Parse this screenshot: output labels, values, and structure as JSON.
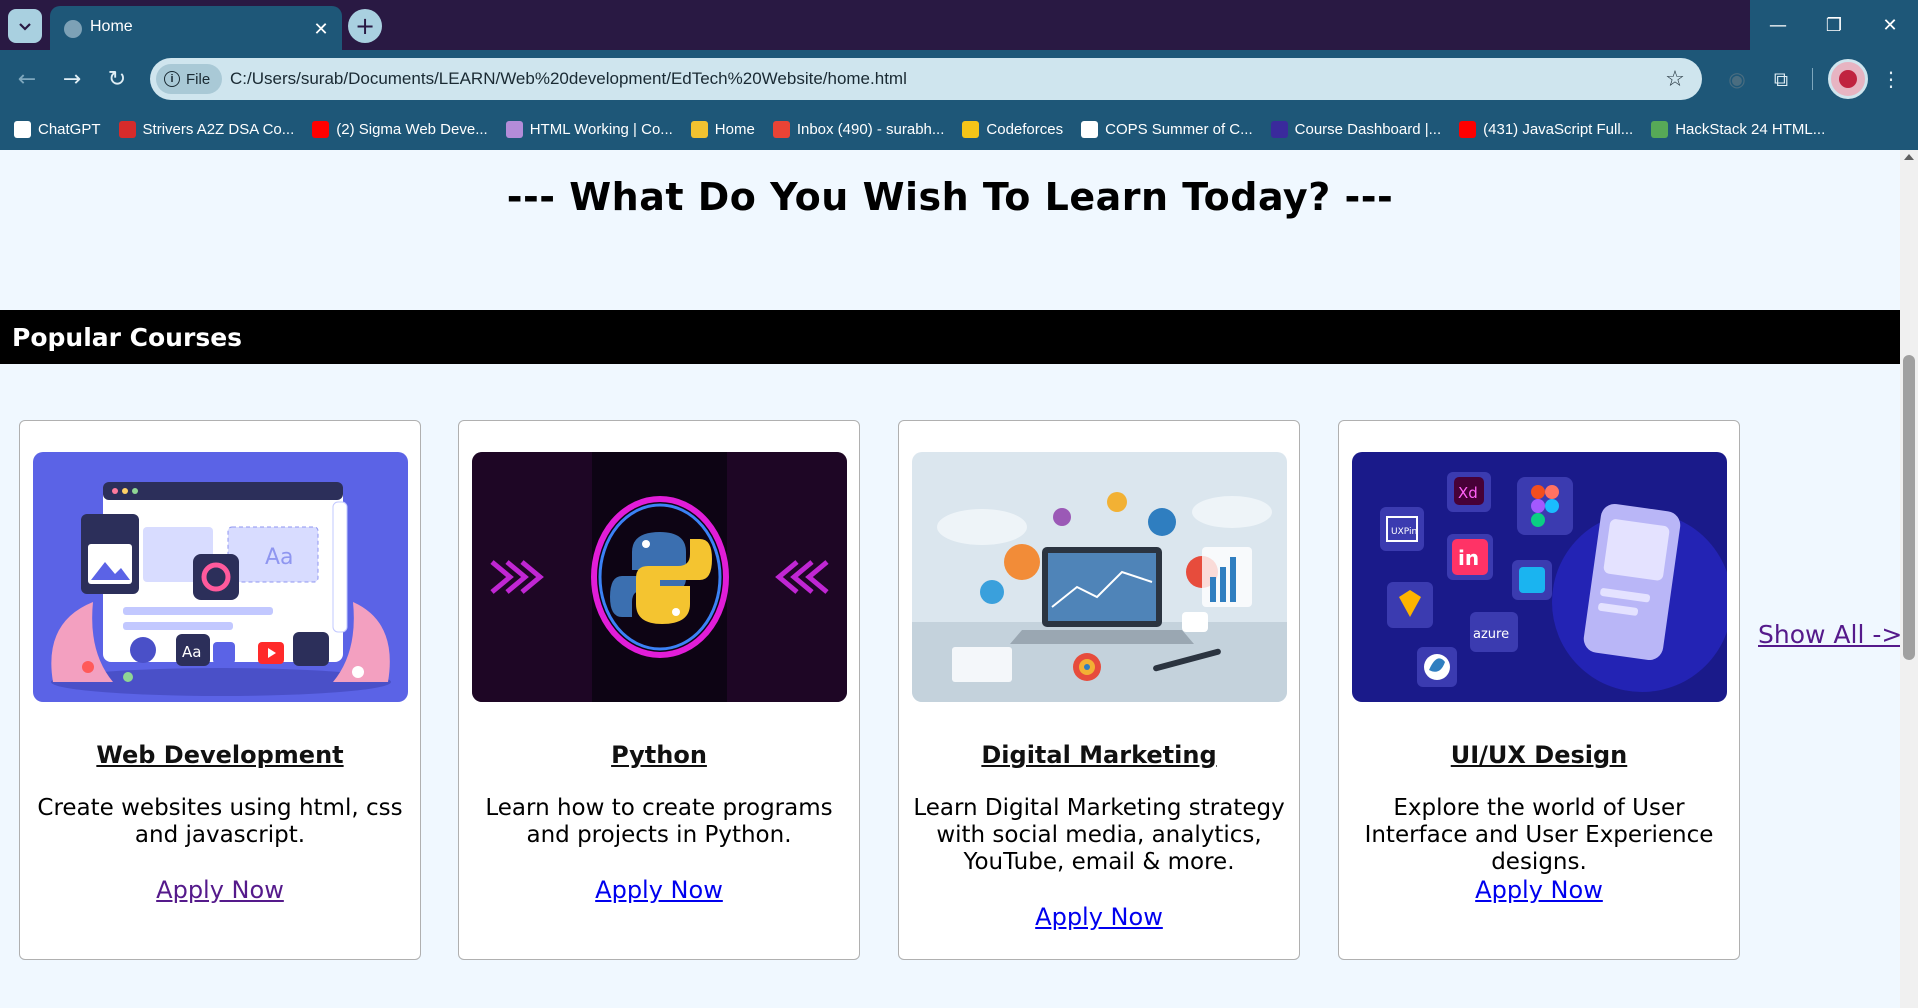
{
  "browser": {
    "tab_title": "Home",
    "tab_close_glyph": "✕",
    "new_tab_glyph": "+",
    "site_chip_label": "File",
    "url": "C:/Users/surab/Documents/LEARN/Web%20development/EdTech%20Website/home.html",
    "window_controls": {
      "minimize": "—",
      "restore": "❐",
      "close": "✕"
    },
    "nav": {
      "back": "←",
      "forward": "→",
      "reload": "↻",
      "star": "☆",
      "menu": "⋮",
      "extension": "⧉",
      "lens": "◉"
    }
  },
  "bookmarks": [
    {
      "label": "ChatGPT",
      "icon_color": "#ffffff"
    },
    {
      "label": "Strivers A2Z DSA Co...",
      "icon_color": "#d62b2b"
    },
    {
      "label": "(2) Sigma Web Deve...",
      "icon_color": "#ff0000"
    },
    {
      "label": "HTML Working | Co...",
      "icon_color": "#b38cd9"
    },
    {
      "label": "Home",
      "icon_color": "#f2c230"
    },
    {
      "label": "Inbox (490) - surabh...",
      "icon_color": "#ea4335"
    },
    {
      "label": "Codeforces",
      "icon_color": "#f5c518"
    },
    {
      "label": "COPS Summer of C...",
      "icon_color": "#ffffff"
    },
    {
      "label": "Course Dashboard |...",
      "icon_color": "#3a2a9c"
    },
    {
      "label": "(431) JavaScript Full...",
      "icon_color": "#ff0000"
    },
    {
      "label": "HackStack 24 HTML...",
      "icon_color": "#57a957"
    }
  ],
  "page": {
    "heading": "--- What Do You Wish To Learn Today? ---",
    "section_title": "Popular Courses",
    "show_all": "Show All ->",
    "courses": [
      {
        "title": "Web Development",
        "description": "Create websites using html, css and javascript.",
        "link": "Apply Now",
        "image": "web-development-illustration"
      },
      {
        "title": "Python",
        "description": "Learn how to create programs and projects in Python.",
        "link": "Apply Now",
        "image": "python-neon-logo"
      },
      {
        "title": "Digital Marketing",
        "description": "Learn Digital Marketing strategy with social media, analytics, YouTube, email & more.",
        "link": "Apply Now",
        "image": "digital-marketing-laptop"
      },
      {
        "title": "UI/UX Design",
        "description": "Explore the world of User Interface and User Experience designs.",
        "link": "Apply Now",
        "image": "uiux-tools-icons"
      }
    ]
  },
  "thumb_labels": {
    "aa": "Aa",
    "xd": "Xd",
    "in": "in",
    "uxpin": "UXPin",
    "azure": "azure"
  },
  "colors": {
    "titlebar": "#291943",
    "toolbar": "#1e5778",
    "page_bg": "#f0f8ff",
    "section_bar": "#000000",
    "link": "#0000ee",
    "visited_link": "#551a8b"
  }
}
